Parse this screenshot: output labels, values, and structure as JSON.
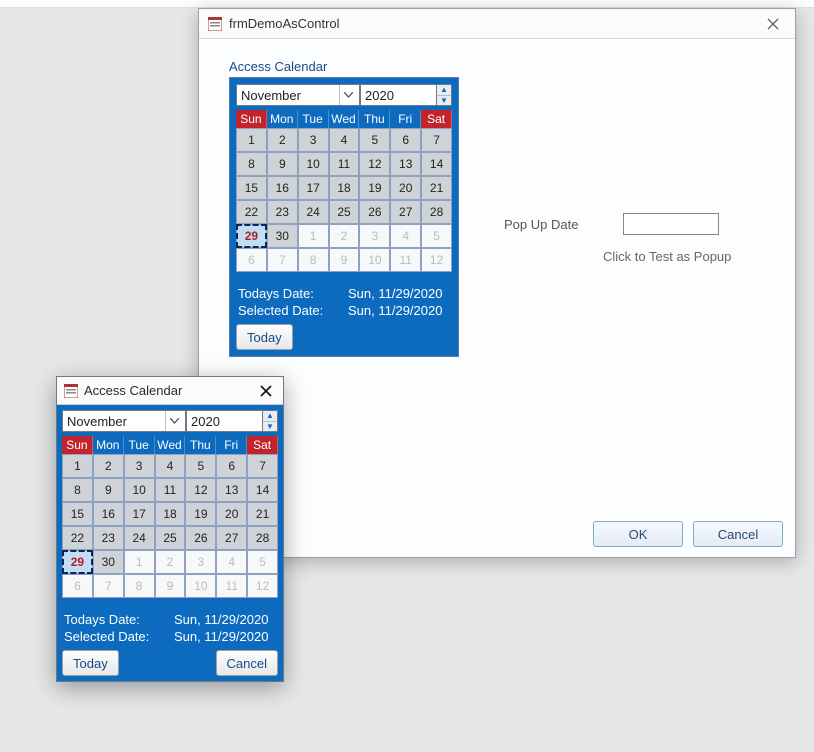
{
  "dialog": {
    "title": "frmDemoAsControl",
    "fieldLabel": "Access Calendar",
    "popupDateLabel": "Pop Up Date",
    "popupHint": "Click to Test as Popup",
    "okLabel": "OK",
    "cancelLabel": "Cancel"
  },
  "popupWindow": {
    "title": "Access Calendar",
    "todayBtn": "Today",
    "cancelBtn": "Cancel"
  },
  "calendar": {
    "month": "November",
    "year": "2020",
    "weekdays": [
      "Sun",
      "Mon",
      "Tue",
      "Wed",
      "Thu",
      "Fri",
      "Sat"
    ],
    "rows": [
      [
        {
          "d": "1"
        },
        {
          "d": "2"
        },
        {
          "d": "3"
        },
        {
          "d": "4"
        },
        {
          "d": "5"
        },
        {
          "d": "6"
        },
        {
          "d": "7"
        }
      ],
      [
        {
          "d": "8"
        },
        {
          "d": "9"
        },
        {
          "d": "10"
        },
        {
          "d": "11"
        },
        {
          "d": "12"
        },
        {
          "d": "13"
        },
        {
          "d": "14"
        }
      ],
      [
        {
          "d": "15"
        },
        {
          "d": "16"
        },
        {
          "d": "17"
        },
        {
          "d": "18"
        },
        {
          "d": "19"
        },
        {
          "d": "20"
        },
        {
          "d": "21"
        }
      ],
      [
        {
          "d": "22"
        },
        {
          "d": "23"
        },
        {
          "d": "24"
        },
        {
          "d": "25"
        },
        {
          "d": "26"
        },
        {
          "d": "27"
        },
        {
          "d": "28"
        }
      ],
      [
        {
          "d": "29",
          "today": true
        },
        {
          "d": "30"
        },
        {
          "d": "1",
          "dim": true
        },
        {
          "d": "2",
          "dim": true
        },
        {
          "d": "3",
          "dim": true
        },
        {
          "d": "4",
          "dim": true
        },
        {
          "d": "5",
          "dim": true
        }
      ],
      [
        {
          "d": "6",
          "dim": true
        },
        {
          "d": "7",
          "dim": true
        },
        {
          "d": "8",
          "dim": true
        },
        {
          "d": "9",
          "dim": true
        },
        {
          "d": "10",
          "dim": true
        },
        {
          "d": "11",
          "dim": true
        },
        {
          "d": "12",
          "dim": true
        }
      ]
    ],
    "todaysLabel": "Todays Date:",
    "todaysValue": "Sun, 11/29/2020",
    "selectedLabel": "Selected Date:",
    "selectedValue": "Sun, 11/29/2020",
    "todayBtn": "Today"
  }
}
